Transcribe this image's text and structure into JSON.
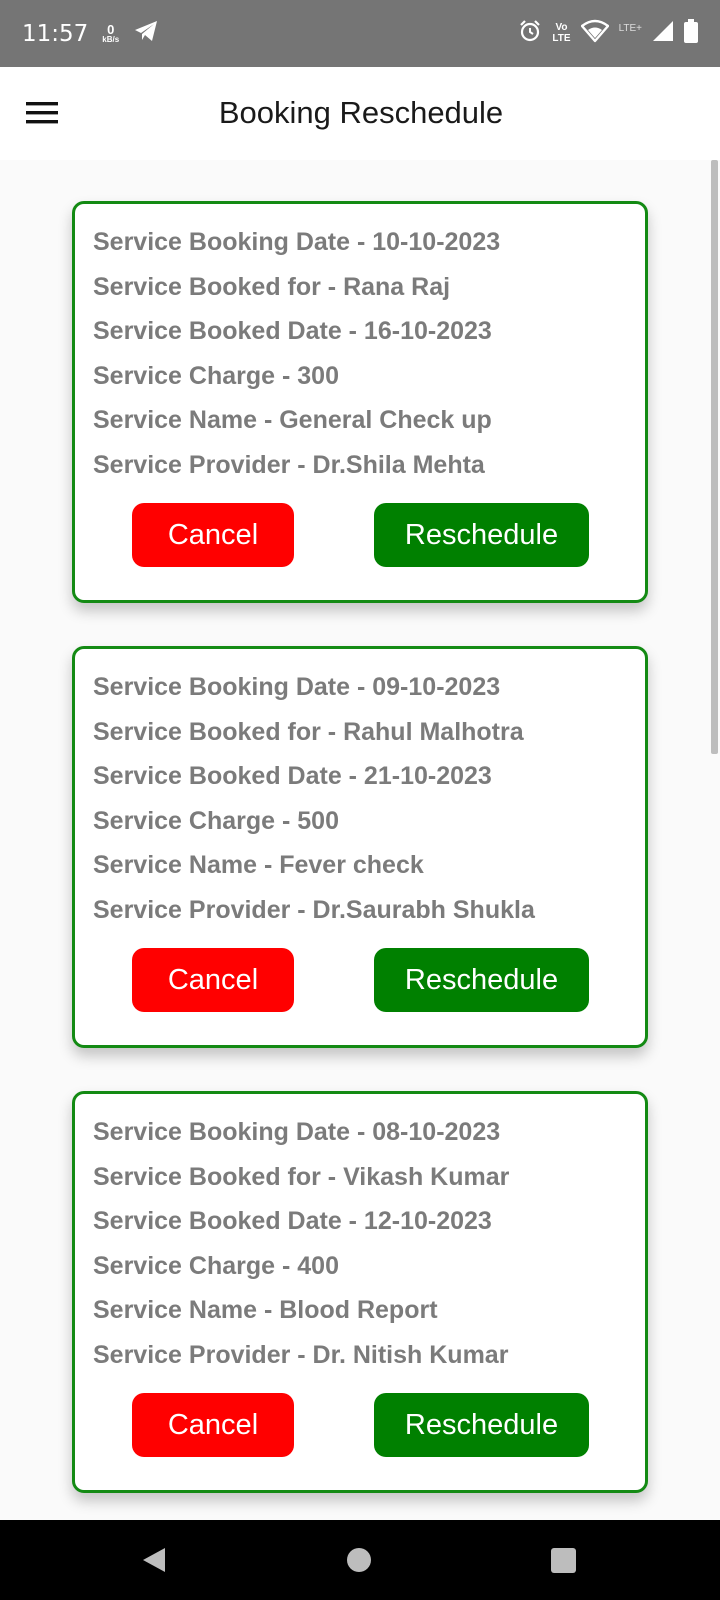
{
  "status_bar": {
    "time": "11:57",
    "speed_value": "0",
    "speed_unit": "kB/s",
    "volte_top": "Vo",
    "volte_bottom": "LTE",
    "network": "LTE+",
    "icons": [
      "telegram-icon",
      "alarm-icon",
      "volte-icon",
      "wifi-icon",
      "signal-icon",
      "battery-icon"
    ]
  },
  "header": {
    "title": "Booking Reschedule",
    "menu_icon": "hamburger-menu-icon"
  },
  "bookings": [
    {
      "booking_date": "Service Booking Date - 10-10-2023",
      "booked_for": "Service Booked for - Rana Raj",
      "booked_date": "Service Booked Date - 16-10-2023",
      "charge": "Service Charge - 300",
      "name": "Service Name - General Check up",
      "provider": "Service Provider - Dr.Shila Mehta",
      "cancel_label": "Cancel",
      "reschedule_label": "Reschedule"
    },
    {
      "booking_date": "Service Booking Date - 09-10-2023",
      "booked_for": "Service Booked for - Rahul Malhotra",
      "booked_date": "Service Booked Date - 21-10-2023",
      "charge": "Service Charge - 500",
      "name": "Service Name - Fever check",
      "provider": "Service Provider - Dr.Saurabh Shukla",
      "cancel_label": "Cancel",
      "reschedule_label": "Reschedule"
    },
    {
      "booking_date": "Service Booking Date - 08-10-2023",
      "booked_for": "Service Booked for - Vikash Kumar",
      "booked_date": "Service Booked Date - 12-10-2023",
      "charge": "Service Charge - 400",
      "name": "Service Name - Blood Report",
      "provider": "Service Provider - Dr. Nitish Kumar",
      "cancel_label": "Cancel",
      "reschedule_label": "Reschedule"
    }
  ],
  "colors": {
    "card_border": "#138a13",
    "cancel": "#ff0000",
    "reschedule": "#008000",
    "text_muted": "#7b7b7b"
  },
  "nav_bar": {
    "icons": [
      "back-icon",
      "home-icon",
      "recents-icon"
    ]
  }
}
